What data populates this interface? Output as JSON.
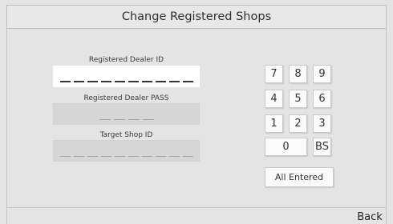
{
  "header": {
    "title": "Change Registered Shops"
  },
  "fields": {
    "dealer_id": {
      "label": "Registered Dealer ID",
      "mask_length": 10
    },
    "dealer_pass": {
      "label": "Registered Dealer PASS",
      "mask_length": 4
    },
    "target_shop_id": {
      "label": "Target Shop ID",
      "mask_length": 10
    }
  },
  "keypad": {
    "keys": [
      "7",
      "8",
      "9",
      "4",
      "5",
      "6",
      "1",
      "2",
      "3"
    ],
    "zero": "0",
    "backspace": "BS",
    "all_entered": "All Entered"
  },
  "footer": {
    "back_label": "Back"
  }
}
